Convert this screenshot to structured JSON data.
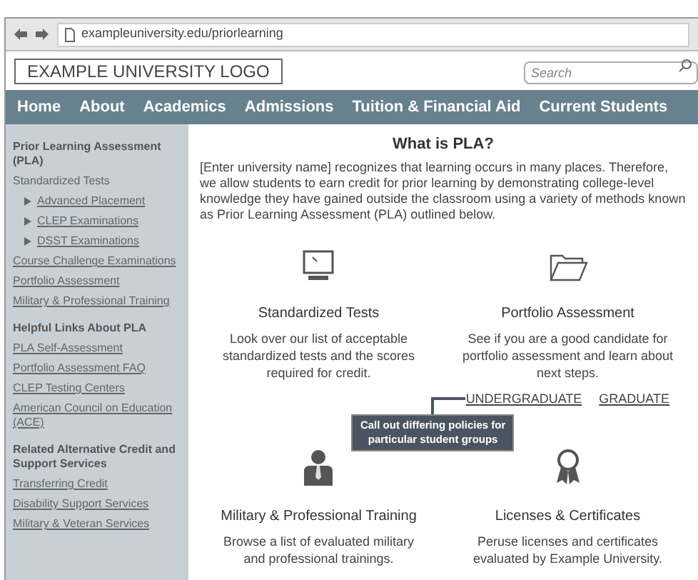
{
  "browser": {
    "url": "exampleuniversity.edu/priorlearning"
  },
  "header": {
    "logo": "EXAMPLE UNIVERSITY LOGO",
    "search": {
      "placeholder": "Search"
    }
  },
  "nav": [
    "Home",
    "About",
    "Academics",
    "Admissions",
    "Tuition & Financial Aid",
    "Current Students"
  ],
  "sidebar": [
    {
      "kind": "heading",
      "label": "Prior Learning Assessment (PLA)"
    },
    {
      "kind": "plain",
      "label": "Standardized Tests"
    },
    {
      "kind": "sublink",
      "label": "Advanced Placement"
    },
    {
      "kind": "sublink",
      "label": "CLEP Examinations"
    },
    {
      "kind": "sublink",
      "label": "DSST Examinations"
    },
    {
      "kind": "link",
      "label": "Course Challenge Examinations"
    },
    {
      "kind": "link",
      "label": "Portfolio Assessment"
    },
    {
      "kind": "link",
      "label": "Military & Professional Training"
    },
    {
      "kind": "heading",
      "label": "Helpful Links About PLA"
    },
    {
      "kind": "link",
      "label": "PLA Self-Assessment"
    },
    {
      "kind": "link",
      "label": "Portfolio Assessment FAQ"
    },
    {
      "kind": "link",
      "label": "CLEP Testing Centers"
    },
    {
      "kind": "link",
      "label": "American Council on Education (ACE)"
    },
    {
      "kind": "heading",
      "label": "Related Alternative Credit and Support Services"
    },
    {
      "kind": "link",
      "label": "Transferring Credit"
    },
    {
      "kind": "link",
      "label": "Disability Support Services"
    },
    {
      "kind": "link",
      "label": "Military & Veteran Services"
    }
  ],
  "main": {
    "title": "What is PLA?",
    "intro": "[Enter university name] recognizes that learning occurs in many places. Therefore, we allow students to earn credit for prior learning by demonstrating college-level knowledge they have gained outside the classroom using a variety of methods known as Prior Learning Assessment (PLA) outlined below.",
    "cards": [
      {
        "kind": "monitor",
        "title": "Standardized Tests",
        "text": "Look over our list of acceptable standardized tests and the scores required for credit."
      },
      {
        "kind": "folder",
        "title": "Portfolio Assessment",
        "text": "See if you are a good candidate for portfolio assessment and learn about next steps.",
        "links": [
          "UNDERGRADUATE",
          "GRADUATE"
        ],
        "callout": "Call out differing policies for particular student groups"
      },
      {
        "kind": "person",
        "title": "Military & Professional Training",
        "text": "Browse a list of evaluated military and professional trainings."
      },
      {
        "kind": "ribbon",
        "title": "Licenses & Certificates",
        "text": "Peruse licenses and certificates evaluated by Example University."
      }
    ]
  }
}
